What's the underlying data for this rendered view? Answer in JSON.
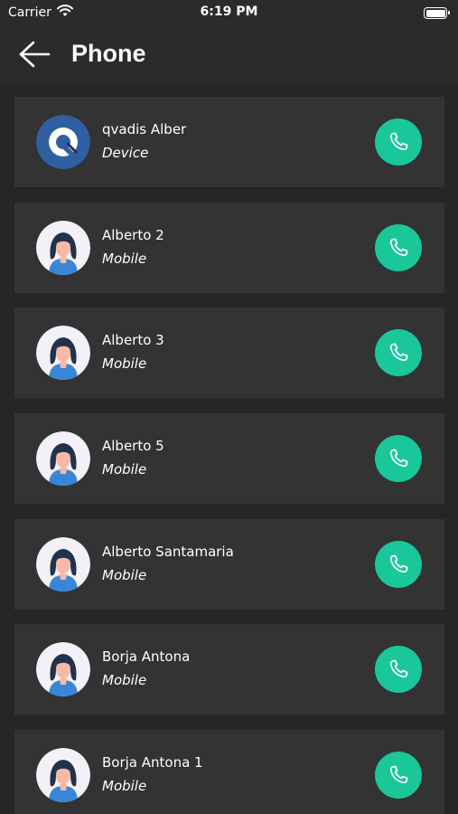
{
  "status_bar": {
    "carrier": "Carrier",
    "time": "6:19 PM"
  },
  "header": {
    "title": "Phone"
  },
  "colors": {
    "accent": "#19c79a",
    "background": "#262626",
    "row_background": "#333333",
    "header_background": "#2b2b2b",
    "logo_blue": "#2f5fa0"
  },
  "contacts": [
    {
      "name": "qvadis Alber",
      "type": "Device",
      "avatar": "qvadis-logo-icon"
    },
    {
      "name": "Alberto 2",
      "type": "Mobile",
      "avatar": "person-avatar-icon"
    },
    {
      "name": "Alberto 3",
      "type": "Mobile",
      "avatar": "person-avatar-icon"
    },
    {
      "name": "Alberto 5",
      "type": "Mobile",
      "avatar": "person-avatar-icon"
    },
    {
      "name": "Alberto Santamaria",
      "type": "Mobile",
      "avatar": "person-avatar-icon"
    },
    {
      "name": "Borja Antona",
      "type": "Mobile",
      "avatar": "person-avatar-icon"
    },
    {
      "name": "Borja Antona 1",
      "type": "Mobile",
      "avatar": "person-avatar-icon"
    }
  ]
}
